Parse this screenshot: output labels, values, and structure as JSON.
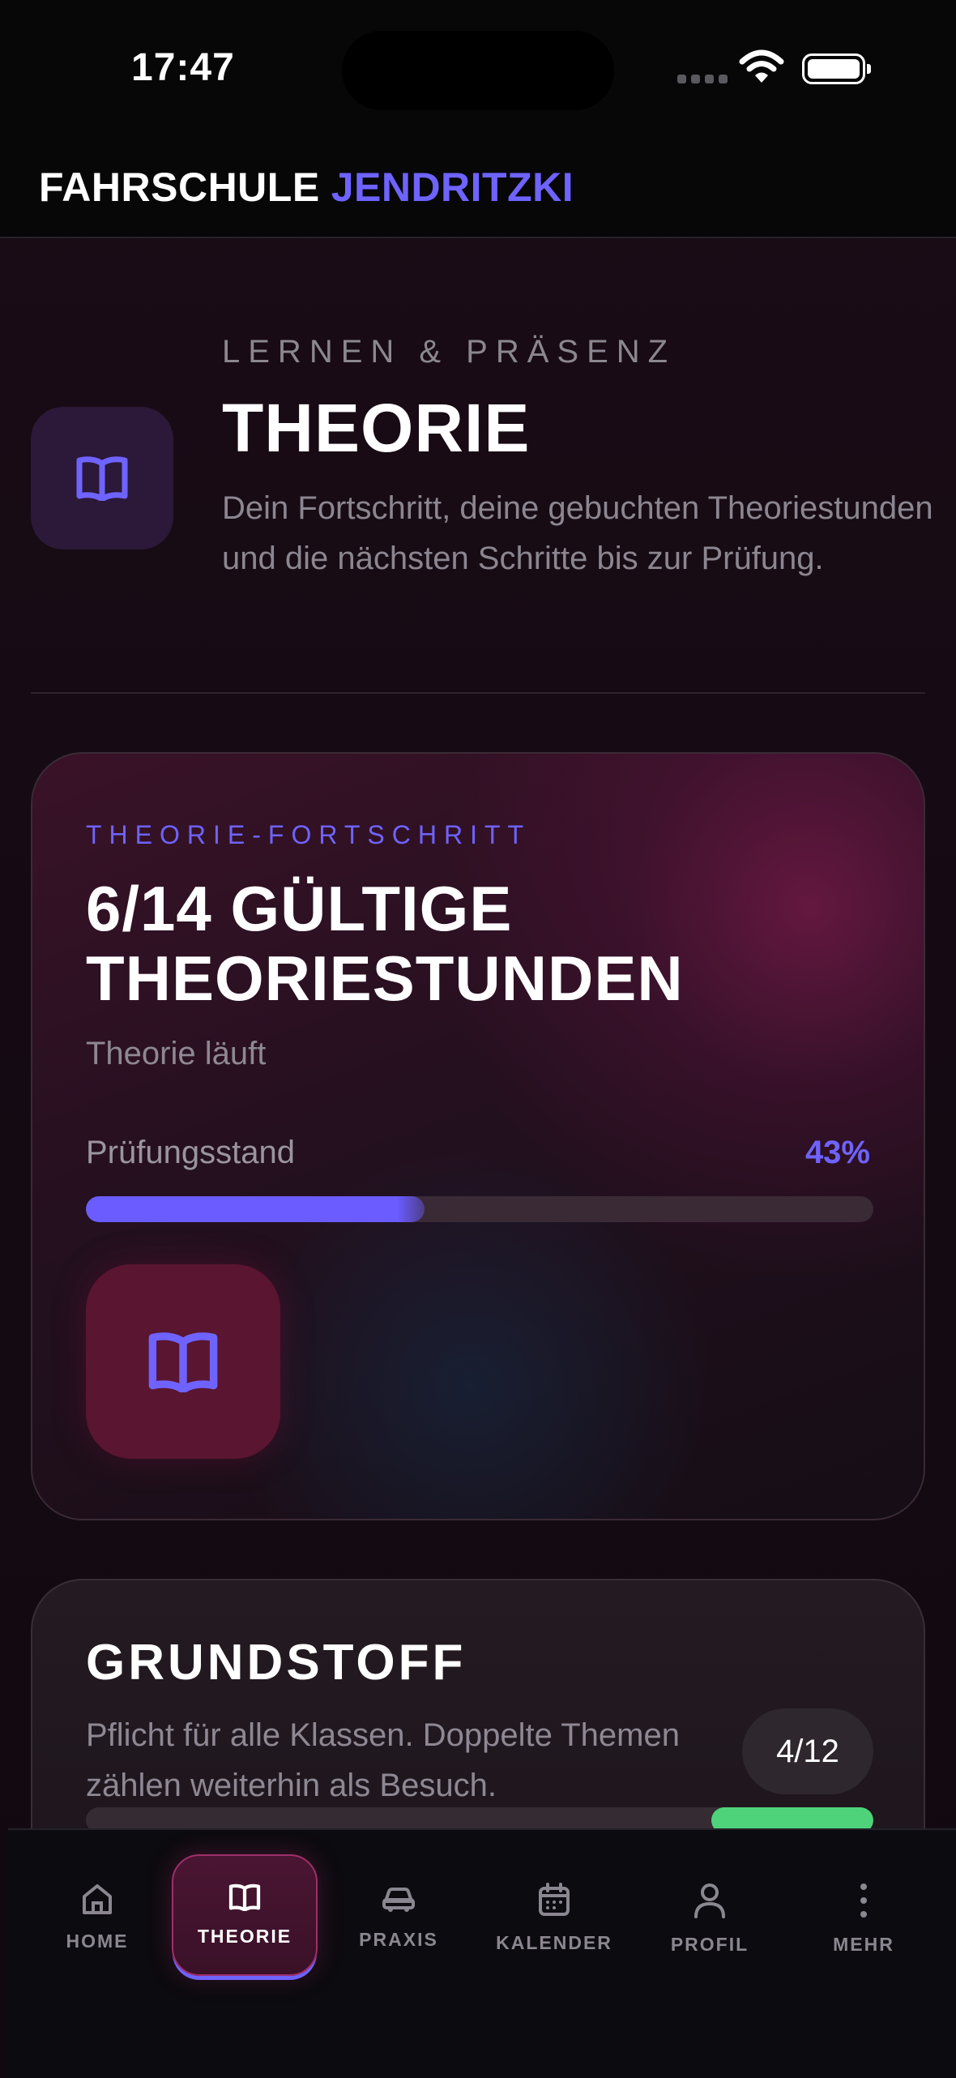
{
  "status_bar": {
    "time": "17:47"
  },
  "app_header": {
    "brand_part1": "FAHRSCHULE",
    "brand_part2": "JENDRITZKI"
  },
  "page": {
    "eyebrow": "LERNEN & PRÄSENZ",
    "title": "THEORIE",
    "description": "Dein Fortschritt, deine gebuchten Theoriestunden und die nächsten Schritte bis zur Prüfung.",
    "icon": "book-icon"
  },
  "progress_card": {
    "eyebrow": "THEORIE-FORTSCHRITT",
    "title": "6/14 GÜLTIGE THEORIESTUNDEN",
    "status": "Theorie läuft",
    "progress_label": "Prüfungsstand",
    "progress_percent_text": "43%",
    "progress_fraction": 0.43,
    "icon": "book-icon"
  },
  "grundstoff_card": {
    "title": "GRUNDSTOFF",
    "description": "Pflicht für alle Klassen. Doppelte Themen zählen weiterhin als Besuch.",
    "badge": "4/12"
  },
  "bottom_nav": {
    "items": [
      {
        "label": "HOME",
        "icon": "home-icon"
      },
      {
        "label": "THEORIE",
        "icon": "book-icon",
        "active": true
      },
      {
        "label": "PRAXIS",
        "icon": "car-icon"
      },
      {
        "label": "KALENDER",
        "icon": "calendar-icon"
      },
      {
        "label": "PROFIL",
        "icon": "person-icon"
      },
      {
        "label": "MEHR",
        "icon": "more-vertical-icon"
      }
    ]
  },
  "colors": {
    "accent": "#6f63ff",
    "success": "#4ed37a",
    "brand_magenta": "#9e2f6b"
  }
}
